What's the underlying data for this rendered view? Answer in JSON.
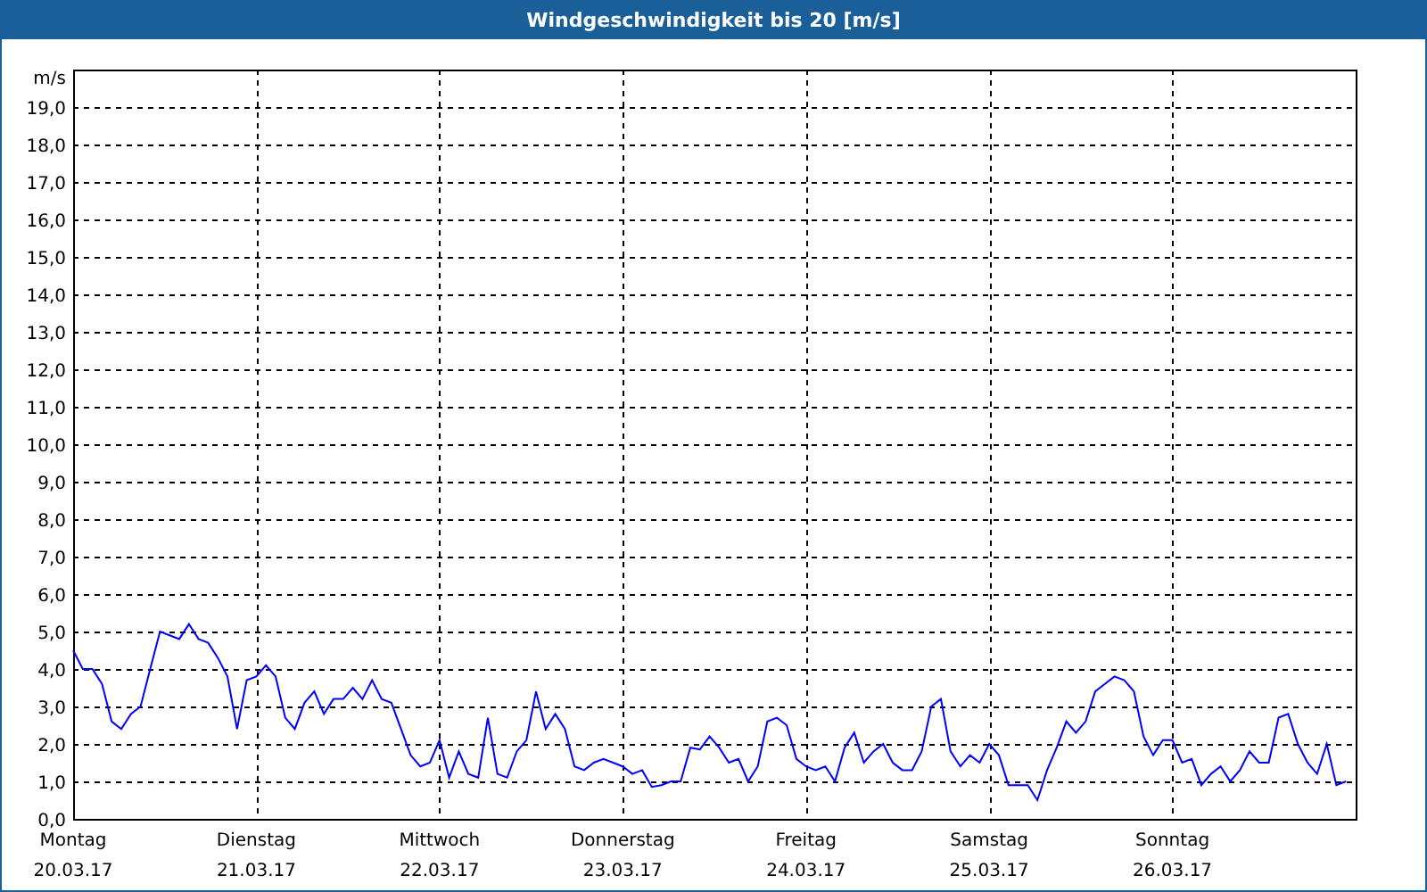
{
  "window": {
    "title": "Windgeschwindigkeit bis 20 [m/s]"
  },
  "chart": {
    "chart_data": {
      "type": "line",
      "grid": true,
      "ylabel": "m/s",
      "ylim": [
        0,
        20
      ],
      "yticks": [
        {
          "value": 0,
          "label": "0,0"
        },
        {
          "value": 1,
          "label": "1,0"
        },
        {
          "value": 2,
          "label": "2,0"
        },
        {
          "value": 3,
          "label": "3,0"
        },
        {
          "value": 4,
          "label": "4,0"
        },
        {
          "value": 5,
          "label": "5,0"
        },
        {
          "value": 6,
          "label": "6,0"
        },
        {
          "value": 7,
          "label": "7,0"
        },
        {
          "value": 8,
          "label": "8,0"
        },
        {
          "value": 9,
          "label": "9,0"
        },
        {
          "value": 10,
          "label": "10,0"
        },
        {
          "value": 11,
          "label": "11,0"
        },
        {
          "value": 12,
          "label": "12,0"
        },
        {
          "value": 13,
          "label": "13,0"
        },
        {
          "value": 14,
          "label": "14,0"
        },
        {
          "value": 15,
          "label": "15,0"
        },
        {
          "value": 16,
          "label": "16,0"
        },
        {
          "value": 17,
          "label": "17,0"
        },
        {
          "value": 18,
          "label": "18,0"
        },
        {
          "value": 19,
          "label": "19,0"
        }
      ],
      "categories": [
        "Montag\n20.03.17",
        null,
        null,
        null,
        null,
        null,
        null,
        null,
        null,
        null,
        null,
        null,
        null,
        null,
        null,
        null,
        null,
        null,
        null,
        "Dienstag\n21.03.17",
        null,
        null,
        null,
        null,
        null,
        null,
        null,
        null,
        null,
        null,
        null,
        null,
        null,
        null,
        null,
        null,
        null,
        null,
        "Mittwoch\n22.03.17",
        null,
        null,
        null,
        null,
        null,
        null,
        null,
        null,
        null,
        null,
        null,
        null,
        null,
        null,
        null,
        null,
        null,
        null,
        "Donnerstag\n23.03.17",
        null,
        null,
        null,
        null,
        null,
        null,
        null,
        null,
        null,
        null,
        null,
        null,
        null,
        null,
        null,
        null,
        null,
        null,
        "Freitag\n24.03.17",
        null,
        null,
        null,
        null,
        null,
        null,
        null,
        null,
        null,
        null,
        null,
        null,
        null,
        null,
        null,
        null,
        null,
        null,
        "Samstag\n25.03.17",
        null,
        null,
        null,
        null,
        null,
        null,
        null,
        null,
        null,
        null,
        null,
        null,
        null,
        null,
        null,
        null,
        null,
        null,
        "Sonntag\n26.03.17",
        null,
        null,
        null,
        null,
        null,
        null,
        null,
        null,
        null,
        null,
        null,
        null,
        null,
        null,
        null,
        null,
        null,
        null
      ],
      "series": [
        {
          "color": "#0000ff",
          "values": [
            4.5,
            4.0,
            4.0,
            3.6,
            2.6,
            2.4,
            2.8,
            3.0,
            4.0,
            5.0,
            4.9,
            4.8,
            5.2,
            4.8,
            4.7,
            4.3,
            3.8,
            2.4,
            3.7,
            3.8,
            4.1,
            3.8,
            2.7,
            2.4,
            3.1,
            3.4,
            2.8,
            3.2,
            3.2,
            3.5,
            3.2,
            3.7,
            3.2,
            3.1,
            2.4,
            1.7,
            1.4,
            1.5,
            2.1,
            1.1,
            1.8,
            1.2,
            1.1,
            2.7,
            1.2,
            1.1,
            1.8,
            2.1,
            3.4,
            2.4,
            2.8,
            2.4,
            1.4,
            1.3,
            1.5,
            1.6,
            1.5,
            1.4,
            1.2,
            1.3,
            0.85,
            0.9,
            1.0,
            1.0,
            1.9,
            1.85,
            2.2,
            1.9,
            1.5,
            1.6,
            1.0,
            1.4,
            2.6,
            2.7,
            2.5,
            1.6,
            1.4,
            1.3,
            1.4,
            1.0,
            1.9,
            2.3,
            1.5,
            1.8,
            2.0,
            1.5,
            1.3,
            1.3,
            1.8,
            3.0,
            3.2,
            1.8,
            1.4,
            1.7,
            1.5,
            2.0,
            1.7,
            0.9,
            0.9,
            0.9,
            0.5,
            1.3,
            1.9,
            2.6,
            2.3,
            2.6,
            3.4,
            3.6,
            3.8,
            3.7,
            3.4,
            2.2,
            1.7,
            2.1,
            2.1,
            1.5,
            1.6,
            0.9,
            1.2,
            1.4,
            1.0,
            1.3,
            1.8,
            1.5,
            1.5,
            2.7,
            2.8,
            2.0,
            1.5,
            1.2,
            2.0,
            0.9,
            1.0
          ]
        }
      ]
    }
  }
}
